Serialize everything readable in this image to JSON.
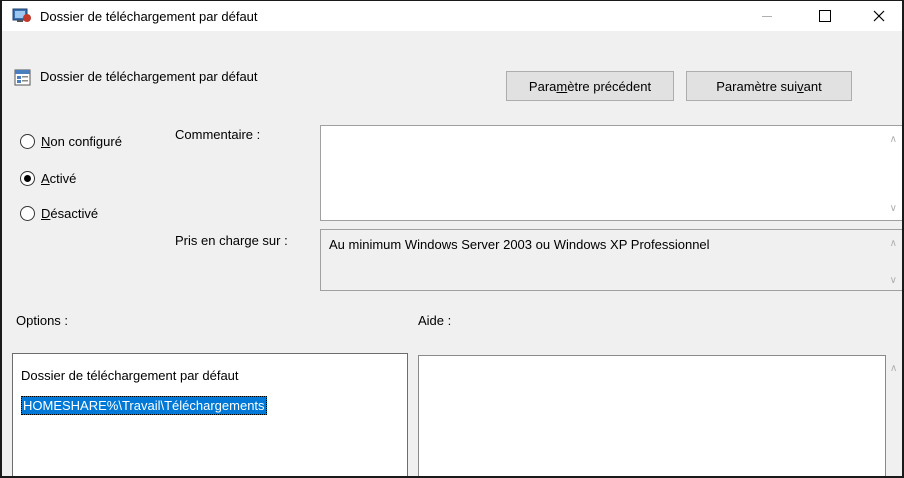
{
  "window": {
    "title": "Dossier de téléchargement par défaut"
  },
  "header": {
    "title": "Dossier de téléchargement par défaut",
    "prev_button": {
      "pre": "Para",
      "accel": "m",
      "post": "ètre précédent"
    },
    "next_button": {
      "pre": "Paramètre sui",
      "accel": "v",
      "post": "ant"
    }
  },
  "state": {
    "not_configured": {
      "accel": "N",
      "rest": "on configuré",
      "selected": false
    },
    "enabled": {
      "accel": "A",
      "rest": "ctivé",
      "selected": true
    },
    "disabled": {
      "accel": "D",
      "rest": "ésactivé",
      "selected": false
    }
  },
  "comment": {
    "label": "Commentaire :",
    "value": ""
  },
  "supported": {
    "label": "Pris en charge sur :",
    "value": "Au minimum Windows Server 2003 ou Windows XP Professionnel"
  },
  "options": {
    "label": "Options :",
    "field_label": "Dossier de téléchargement par défaut",
    "field_value": "HOMESHARE%\\Travail\\Téléchargements"
  },
  "help": {
    "label": "Aide :"
  },
  "icons": {
    "app": "policy-app-icon",
    "setting": "policy-setting-icon",
    "minimize": "minimize-icon",
    "maximize": "maximize-icon",
    "close": "close-icon",
    "scroll_up": "scroll-up-icon",
    "scroll_down": "scroll-down-icon"
  }
}
